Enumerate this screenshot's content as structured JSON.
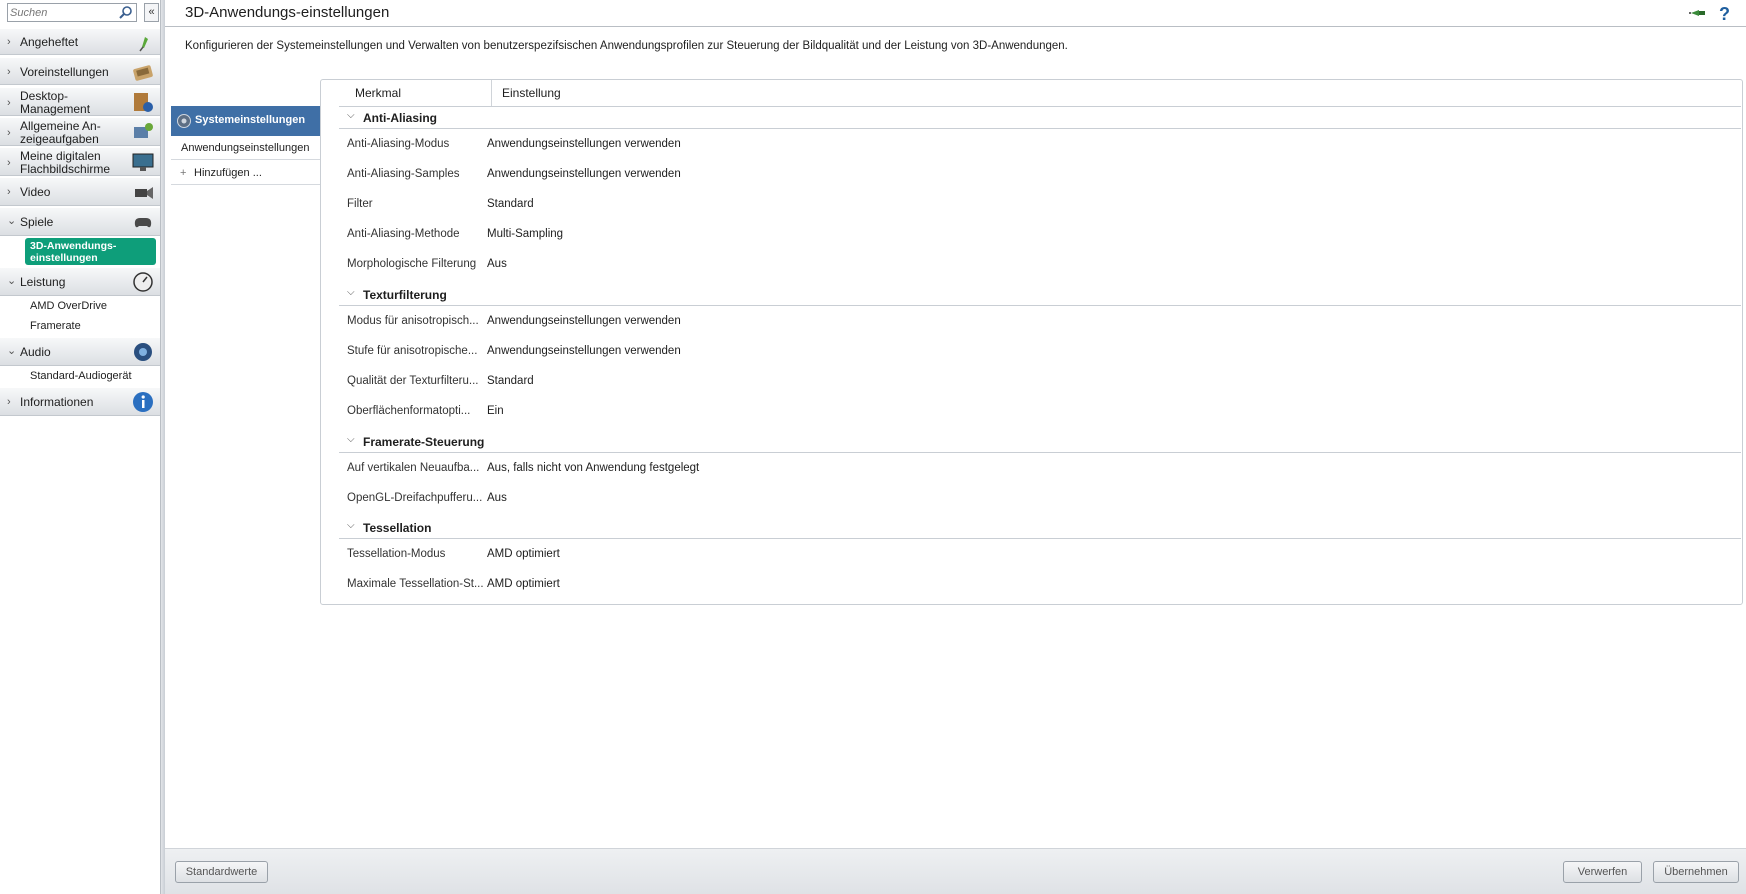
{
  "sidebar": {
    "search_placeholder": "Suchen",
    "collapse_label": "«",
    "items": [
      {
        "label": "Angeheftet",
        "chevron": "›",
        "icon": "pin-icon"
      },
      {
        "label": "Voreinstellungen",
        "chevron": "›",
        "icon": "presets-icon"
      },
      {
        "label": "Desktop-\nManagement",
        "chevron": "›",
        "icon": "desktop-management-icon"
      },
      {
        "label": "Allgemeine An-\nzeigeaufgaben",
        "chevron": "›",
        "icon": "display-tasks-icon"
      },
      {
        "label": "Meine digitalen\nFlachbildschirme",
        "chevron": "›",
        "icon": "flatpanel-icon"
      },
      {
        "label": "Video",
        "chevron": "›",
        "icon": "video-camera-icon"
      },
      {
        "label": "Spiele",
        "chevron": "⌄",
        "icon": "gamepad-icon"
      },
      {
        "label": "Leistung",
        "chevron": "⌄",
        "icon": "speedometer-icon"
      },
      {
        "label": "Audio",
        "chevron": "⌄",
        "icon": "audio-icon"
      },
      {
        "label": "Informationen",
        "chevron": "›",
        "icon": "info-icon"
      }
    ],
    "spiele_sub_active": "3D-Anwendungs-\neinstellungen",
    "leistung_sub": [
      "AMD OverDrive",
      "Framerate"
    ],
    "audio_sub": [
      "Standard-Audiogerät"
    ]
  },
  "header": {
    "title": "3D-Anwendungs-einstellungen",
    "description": "Konfigurieren der Systemeinstellungen und Verwalten von benutzerspezifsischen Anwendungsprofilen zur Steuerung der Bildqualität und der Leistung von 3D-Anwendungen."
  },
  "tabs": {
    "active": "Systemeinstellungen",
    "app_settings": "Anwendungseinstellungen",
    "add": "Hinzufügen ...",
    "add_prefix": "+"
  },
  "table": {
    "col_feature": "Merkmal",
    "col_setting": "Einstellung",
    "groups": [
      {
        "title": "Anti-Aliasing",
        "rows": [
          {
            "label": "Anti-Aliasing-Modus",
            "value": "Anwendungseinstellungen verwenden"
          },
          {
            "label": "Anti-Aliasing-Samples",
            "value": "Anwendungseinstellungen verwenden"
          },
          {
            "label": "Filter",
            "value": "Standard"
          },
          {
            "label": "Anti-Aliasing-Methode",
            "value": "Multi-Sampling"
          },
          {
            "label": "Morphologische Filterung",
            "value": "Aus"
          }
        ]
      },
      {
        "title": "Texturfilterung",
        "rows": [
          {
            "label": "Modus für anisotropisch...",
            "value": "Anwendungseinstellungen verwenden"
          },
          {
            "label": "Stufe für anisotropische...",
            "value": "Anwendungseinstellungen verwenden"
          },
          {
            "label": "Qualität der Texturfilteru...",
            "value": "Standard"
          },
          {
            "label": "Oberflächenformatopti...",
            "value": "Ein"
          }
        ]
      },
      {
        "title": "Framerate-Steuerung",
        "rows": [
          {
            "label": "Auf vertikalen Neuaufba...",
            "value": "Aus, falls nicht von Anwendung festgelegt"
          },
          {
            "label": "OpenGL-Dreifachpufferu...",
            "value": "Aus"
          }
        ]
      },
      {
        "title": "Tessellation",
        "rows": [
          {
            "label": "Tessellation-Modus",
            "value": "AMD optimiert"
          },
          {
            "label": "Maximale Tessellation-St...",
            "value": "AMD optimiert"
          }
        ]
      }
    ]
  },
  "footer": {
    "defaults": "Standardwerte",
    "discard": "Verwerfen",
    "apply": "Übernehmen"
  },
  "colors": {
    "active_tab": "#3f6fa6",
    "active_nav": "#0e9e7a"
  }
}
